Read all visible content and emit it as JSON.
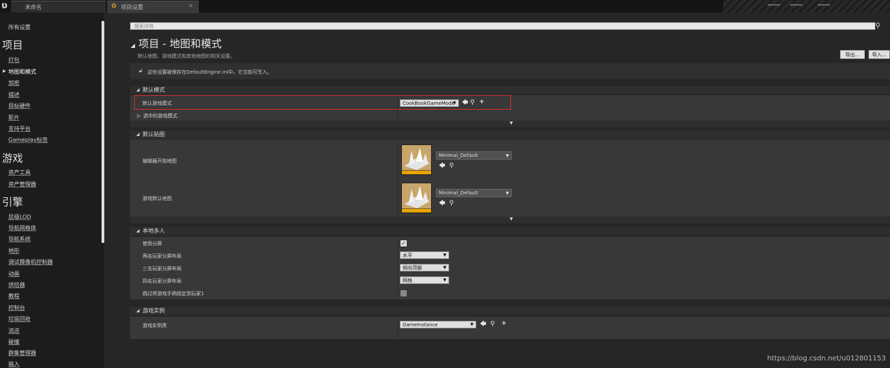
{
  "tabs": [
    {
      "label": "未命名",
      "active": false
    },
    {
      "label": "项目设置",
      "active": true,
      "close": "×"
    }
  ],
  "sidebar": {
    "all_settings": "所有设置",
    "sections": [
      {
        "heading": "项目",
        "items": [
          "打包",
          "地图和模式",
          "加密",
          "描述",
          "目标硬件",
          "影片",
          "支持平台",
          "Gameplay标签"
        ]
      },
      {
        "heading": "游戏",
        "items": [
          "资产工具",
          "资产管理器"
        ]
      },
      {
        "heading": "引擎",
        "items": [
          "层级LOD",
          "导航网格体",
          "导航系统",
          "地形",
          "调试摄像机控制器",
          "动画",
          "烘焙器",
          "教程",
          "控制台",
          "垃圾回收",
          "流送",
          "碰撞",
          "群集管理器",
          "输入"
        ]
      }
    ],
    "selected": "地图和模式"
  },
  "search": {
    "placeholder": "搜索详情"
  },
  "page": {
    "title": "项目 - 地图和模式",
    "subtitle": "默认地图、游戏模式和其他地图的相关设置。",
    "export_btn": "导出...",
    "import_btn": "导入...",
    "notice": "这些设置被保存在DefaultEngine.ini中，它当前可写入。"
  },
  "default_modes": {
    "header": "默认模式",
    "game_mode_label": "默认游戏模式",
    "game_mode_value": "CookBookGameMode",
    "selected_mode_label": "选中的游戏模式"
  },
  "default_maps": {
    "header": "默认贴图",
    "editor_map_label": "编辑器开始地图",
    "editor_map_value": "Minimal_Default",
    "game_map_label": "游戏默认地图",
    "game_map_value": "Minimal_Default"
  },
  "local_multiplayer": {
    "header": "本地多人",
    "split_label": "使用分屏",
    "split_checked": true,
    "two_label": "两名玩家分屏布局",
    "two_value": "水平",
    "three_label": "三名玩家分屏布局",
    "three_value": "倾向顶部",
    "four_label": "四名玩家分屏布局",
    "four_value": "网格",
    "skip_label": "跳过将游戏手柄指定到玩家1",
    "skip_checked": false
  },
  "game_instance": {
    "header": "游戏实例",
    "class_label": "游戏实例类",
    "class_value": "GameInstance"
  },
  "watermark": "https://blog.csdn.net/u012801153",
  "colors": {
    "highlight": "#d32f2f",
    "accent_bar": "#e8a500"
  }
}
